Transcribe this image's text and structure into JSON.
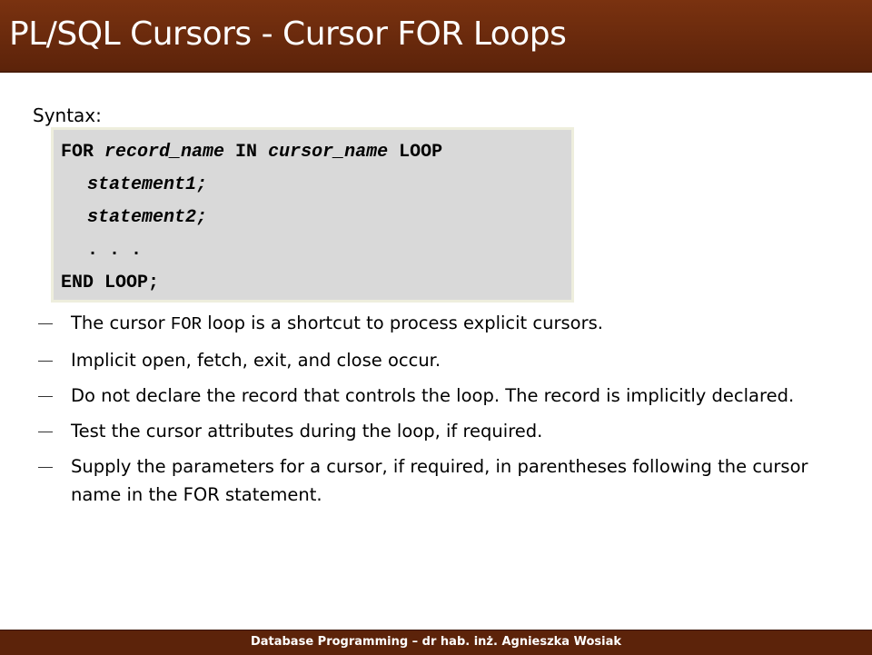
{
  "slide": {
    "title": "PL/SQL Cursors - Cursor FOR Loops",
    "syntax_label": "Syntax:"
  },
  "code": {
    "line1": {
      "kw1": "FOR ",
      "v1": "record_name",
      "kw2": " IN ",
      "v2": "cursor_name",
      "kw3": " LOOP"
    },
    "line2": "statement1;",
    "line3": "statement2;",
    "line4": ". . .",
    "line5": "END LOOP;"
  },
  "bullets": {
    "b1": {
      "pre": "The cursor ",
      "code": "FOR",
      "post": " loop is a shortcut to process explicit cursors."
    },
    "b2": "Implicit open, fetch, exit, and close occur.",
    "b3": "Do not declare the record that controls the loop. The record is implicitly declared.",
    "b4": "Test the cursor attributes during the loop, if required.",
    "b5": "Supply the parameters for a cursor, if required, in parentheses following the cursor name in the FOR statement."
  },
  "footer": {
    "text": "Database Programming – dr hab. inż. Agnieszka Wosiak"
  }
}
